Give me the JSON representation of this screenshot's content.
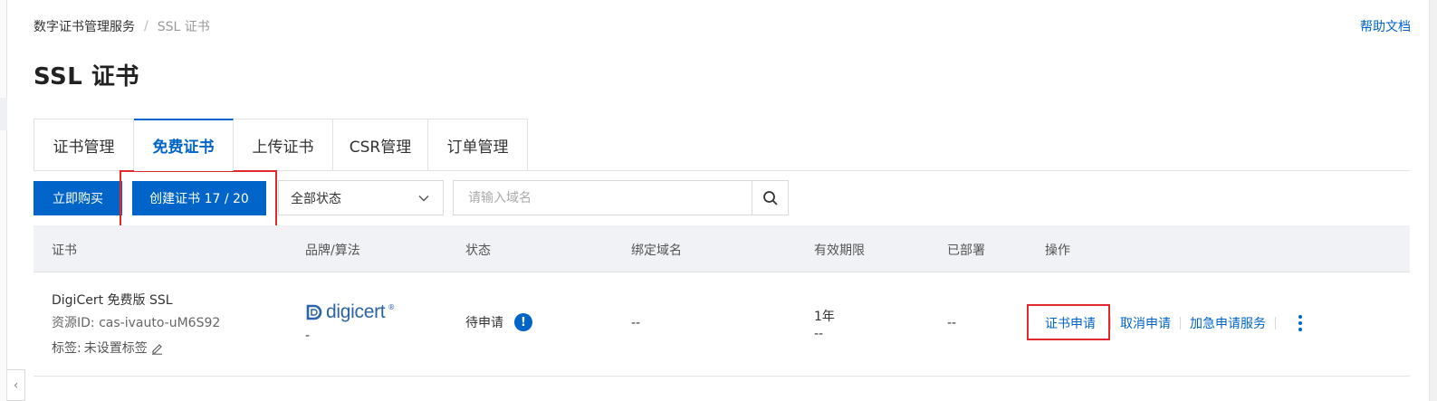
{
  "breadcrumb": {
    "parent": "数字证书管理服务",
    "separator": "/",
    "current": "SSL 证书"
  },
  "help_link": "帮助文档",
  "page_title": "SSL 证书",
  "tabs": [
    {
      "label": "证书管理",
      "active": false
    },
    {
      "label": "免费证书",
      "active": true
    },
    {
      "label": "上传证书",
      "active": false
    },
    {
      "label": "CSR管理",
      "active": false
    },
    {
      "label": "订单管理",
      "active": false
    }
  ],
  "toolbar": {
    "buy_label": "立即购买",
    "create_label": "创建证书 17 / 20",
    "status_filter_value": "全部状态",
    "search_placeholder": "请输入域名"
  },
  "table": {
    "headers": [
      "证书",
      "品牌/算法",
      "状态",
      "绑定域名",
      "有效期限",
      "已部署",
      "操作"
    ],
    "rows": [
      {
        "cert_name": "DigiCert 免费版 SSL",
        "resource_id_label": "资源ID:",
        "resource_id": "cas-ivauto-uM6S92",
        "tag_label": "标签:",
        "tag_value": "未设置标签",
        "brand_logo_text": "digicert",
        "brand_logo_reg": "®",
        "algorithm": "-",
        "status": "待申请",
        "status_icon": "!",
        "bound_domain": "--",
        "validity_period": "1年",
        "validity_range": "--",
        "deployed": "--",
        "actions": [
          "证书申请",
          "取消申请",
          "加急申请服务"
        ]
      }
    ]
  },
  "colors": {
    "primary": "#0064c8",
    "highlight": "#e0282e",
    "header_bg": "#f0f2f5"
  },
  "icons": [
    "chevron-down-icon",
    "search-icon",
    "edit-icon",
    "info-alert-icon",
    "more-vertical-icon",
    "collapse-left-icon"
  ]
}
